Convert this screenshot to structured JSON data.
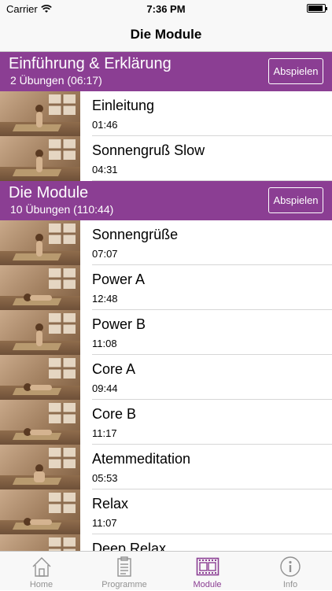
{
  "status_bar": {
    "carrier": "Carrier",
    "time": "7:36 PM",
    "battery_level": 0.92
  },
  "nav": {
    "title": "Die Module"
  },
  "sections": [
    {
      "title": "Einführung & Erklärung",
      "subtitle": "2 Übungen (06:17)",
      "play_label": "Abspielen",
      "items": [
        {
          "name": "Einleitung",
          "duration": "01:46",
          "thumb": "standing"
        },
        {
          "name": "Sonnengruß Slow",
          "duration": "04:31",
          "thumb": "standing"
        }
      ]
    },
    {
      "title": "Die Module",
      "subtitle": "10 Übungen (110:44)",
      "play_label": "Abspielen",
      "items": [
        {
          "name": "Sonnengrüße",
          "duration": "07:07",
          "thumb": "standing"
        },
        {
          "name": "Power A",
          "duration": "12:48",
          "thumb": "lying"
        },
        {
          "name": "Power B",
          "duration": "11:08",
          "thumb": "standing"
        },
        {
          "name": "Core A",
          "duration": "09:44",
          "thumb": "lying"
        },
        {
          "name": "Core B",
          "duration": "11:17",
          "thumb": "lying"
        },
        {
          "name": "Atemmeditation",
          "duration": "05:53",
          "thumb": "seated"
        },
        {
          "name": "Relax",
          "duration": "11:07",
          "thumb": "lying"
        },
        {
          "name": "Deep Relax",
          "duration": "",
          "thumb": "lying"
        }
      ]
    }
  ],
  "tabs": [
    {
      "label": "Home",
      "icon": "house-icon",
      "active": false
    },
    {
      "label": "Programme",
      "icon": "clipboard-icon",
      "active": false
    },
    {
      "label": "Module",
      "icon": "film-icon",
      "active": true
    },
    {
      "label": "Info",
      "icon": "info-icon",
      "active": false
    }
  ],
  "colors": {
    "accent": "#8b3e93",
    "tab_inactive": "#929292",
    "bar_background": "#f8f8f8"
  }
}
